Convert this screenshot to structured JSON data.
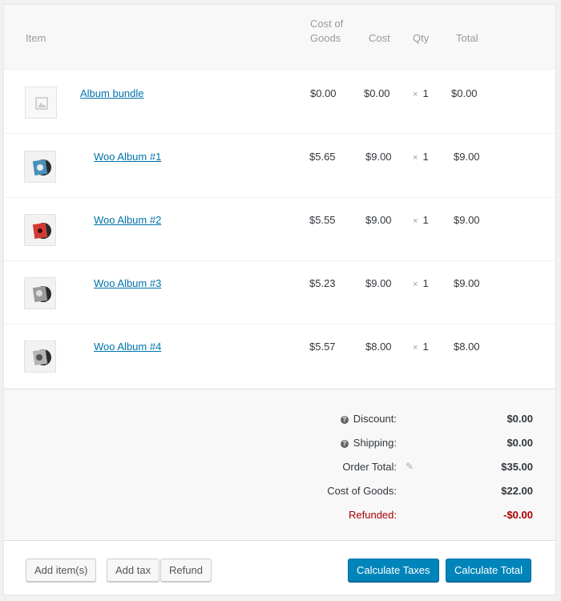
{
  "table": {
    "headers": {
      "item": "Item",
      "cost_of_goods": "Cost of Goods",
      "cost": "Cost",
      "qty": "Qty",
      "total": "Total"
    },
    "rows": [
      {
        "name": "Album bundle",
        "cog": "$0.00",
        "cost": "$0.00",
        "qty_prefix": "×",
        "qty": "1",
        "total": "$0.00",
        "thumb": "placeholder-image-icon"
      },
      {
        "name": "Woo Album #1",
        "cog": "$5.65",
        "cost": "$9.00",
        "qty_prefix": "×",
        "qty": "1",
        "total": "$9.00",
        "thumb": "album-1-image",
        "color": "#4a90b8"
      },
      {
        "name": "Woo Album #2",
        "cog": "$5.55",
        "cost": "$9.00",
        "qty_prefix": "×",
        "qty": "1",
        "total": "$9.00",
        "thumb": "album-2-image",
        "color": "#d23b35"
      },
      {
        "name": "Woo Album #3",
        "cog": "$5.23",
        "cost": "$9.00",
        "qty_prefix": "×",
        "qty": "1",
        "total": "$9.00",
        "thumb": "album-3-image",
        "color": "#9a9a9a"
      },
      {
        "name": "Woo Album #4",
        "cog": "$5.57",
        "cost": "$8.00",
        "qty_prefix": "×",
        "qty": "1",
        "total": "$8.00",
        "thumb": "album-4-image",
        "color": "#b5b5b5"
      }
    ]
  },
  "totals": {
    "discount_label": "Discount:",
    "discount_value": "$0.00",
    "shipping_label": "Shipping:",
    "shipping_value": "$0.00",
    "order_total_label": "Order Total:",
    "order_total_value": "$35.00",
    "cog_label": "Cost of Goods:",
    "cog_value": "$22.00",
    "refunded_label": "Refunded:",
    "refunded_value": "-$0.00",
    "help_icon": "?",
    "edit_icon": "✎"
  },
  "buttons": {
    "add_items": "Add item(s)",
    "add_tax": "Add tax",
    "refund": "Refund",
    "calculate_taxes": "Calculate Taxes",
    "calculate_total": "Calculate Total"
  },
  "colors": {
    "link": "#0073aa",
    "primary": "#0085ba",
    "refund": "#aa0000"
  }
}
